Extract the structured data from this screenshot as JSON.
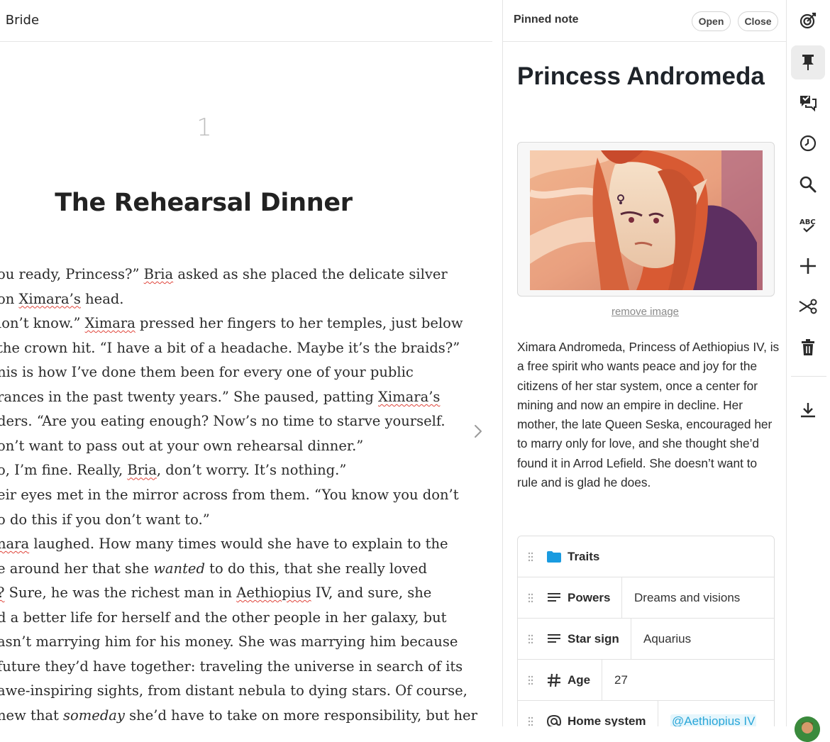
{
  "editor": {
    "doc_title": ": Bride",
    "chapter_number": "1",
    "chapter_title": "The Rehearsal Dinner",
    "lines": [
      [
        {
          "t": "ou ready, Princess?” "
        },
        {
          "t": "Bria",
          "sp": true
        },
        {
          "t": " asked as she placed the delicate silver"
        }
      ],
      [
        {
          "t": " on "
        },
        {
          "t": "Ximara’s",
          "sp": true
        },
        {
          "t": " head."
        }
      ],
      [
        {
          "t": "lon’t know.” "
        },
        {
          "t": "Ximara",
          "sp": true
        },
        {
          "t": " pressed her fingers to her temples, just below"
        }
      ],
      [
        {
          "t": " the crown hit. “I have a bit of a headache. Maybe it’s the braids?”"
        }
      ],
      [
        {
          "t": "nis is how I’ve done them been for every one of your public"
        }
      ],
      [
        {
          "t": "rances in the past twenty years.” She paused, patting "
        },
        {
          "t": "Ximara’s",
          "sp": true
        }
      ],
      [
        {
          "t": "ders. “Are you eating enough? Now’s no time to starve yourself."
        }
      ],
      [
        {
          "t": "on’t want to pass out at your own rehearsal dinner.”"
        }
      ],
      [
        {
          "t": "o, I’m fine. Really, "
        },
        {
          "t": "Bria",
          "sp": true
        },
        {
          "t": ", don’t worry. It’s nothing.”"
        }
      ],
      [
        {
          "t": "eir eyes met in the mirror across from them. “You know you don’t"
        }
      ],
      [
        {
          "t": "o do this if you don’t want to.”"
        }
      ],
      [
        {
          "t": "nara",
          "sp": true
        },
        {
          "t": " laughed. How many times would she have to explain to the"
        }
      ],
      [
        {
          "t": "e around her that she "
        },
        {
          "t": "wanted",
          "i": true
        },
        {
          "t": " to do this, that she really loved"
        }
      ],
      [
        {
          "t": "?",
          "sp": true
        },
        {
          "t": " Sure, he was the richest man in "
        },
        {
          "t": "Aethiopius",
          "sp": true
        },
        {
          "t": " IV, and sure, she"
        }
      ],
      [
        {
          "t": "d a better life for herself and the other people in her galaxy, but"
        }
      ],
      [
        {
          "t": "asn’t marrying him for his money. She was marrying him because"
        }
      ],
      [
        {
          "t": " future they’d have together: traveling the universe in search of its"
        }
      ],
      [
        {
          "t": "awe-inspiring sights, from distant nebula to dying stars. Of course,"
        }
      ],
      [
        {
          "t": "new that "
        },
        {
          "t": "someday",
          "i": true
        },
        {
          "t": " she’d have to take on more responsibility, but her"
        }
      ]
    ]
  },
  "panel": {
    "title": "Pinned note",
    "open_label": "Open",
    "close_label": "Close",
    "note_name": "Princess Andromeda",
    "remove_image_label": "remove image",
    "description": "Ximara Andromeda, Princess of Aethiopius IV, is a free spirit who wants peace and joy for the citizens of her star system, once a center for mining and now an empire in decline. Her mother, the late Queen Seska, encouraged her to marry only for love, and she thought she’d found it in Arrod Lefield. She doesn’t want to rule and is glad he does.",
    "properties": {
      "traits": {
        "key": "Traits",
        "icon": "folder-icon"
      },
      "powers": {
        "key": "Powers",
        "value": "Dreams and visions",
        "icon": "text-lines-icon"
      },
      "star_sign": {
        "key": "Star sign",
        "value": "Aquarius",
        "icon": "text-lines-icon"
      },
      "age": {
        "key": "Age",
        "value": "27",
        "icon": "hash-icon"
      },
      "home_system": {
        "key": "Home system",
        "value": "@Aethiopius IV",
        "icon": "at-sign-icon"
      }
    }
  },
  "toolbar": {
    "items": [
      "target-icon",
      "pin-icon",
      "comments-icon",
      "history-icon",
      "search-icon",
      "spellcheck-icon",
      "add-icon",
      "scissors-icon",
      "trash-icon",
      "download-icon"
    ],
    "active": "pin-icon"
  },
  "colors": {
    "accent_link": "#2aa6d8",
    "folder": "#1a9be0",
    "spellcheck_underline": "#e0453b",
    "active_tool_bg": "#ececec"
  }
}
